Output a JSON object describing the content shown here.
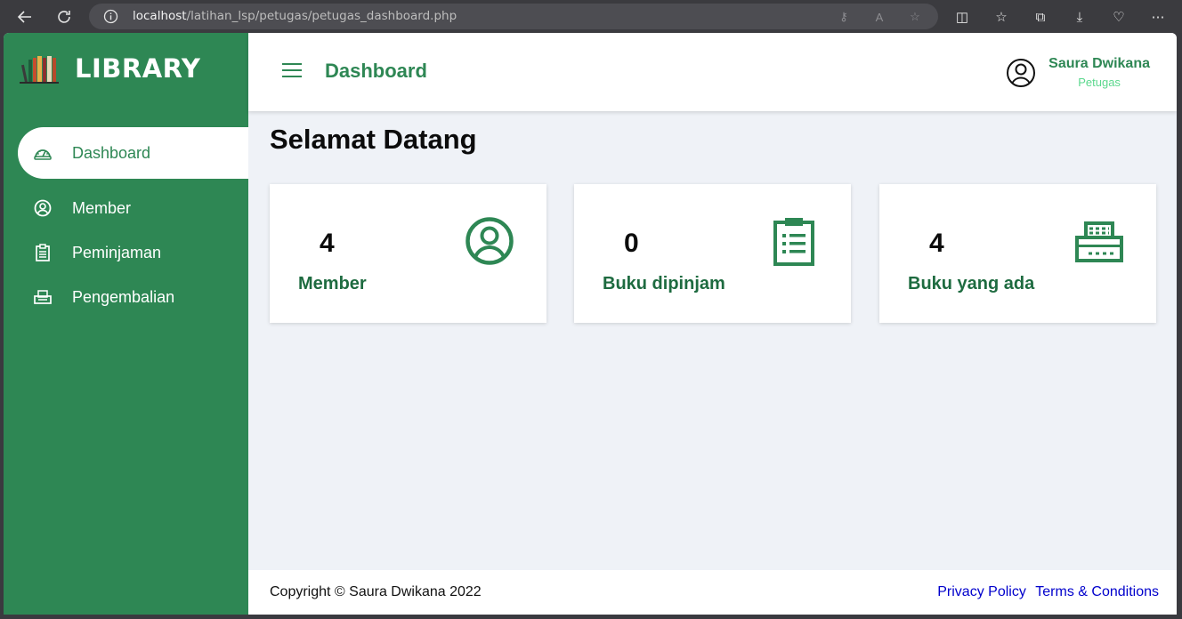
{
  "browser": {
    "url_host": "localhost",
    "url_path": "/latihan_lsp/petugas/petugas_dashboard.php"
  },
  "sidebar": {
    "brand": "LIBRARY",
    "items": [
      {
        "label": "Dashboard",
        "icon": "dashboard-icon",
        "active": true
      },
      {
        "label": "Member",
        "icon": "user-circle-icon",
        "active": false
      },
      {
        "label": "Peminjaman",
        "icon": "clipboard-icon",
        "active": false
      },
      {
        "label": "Pengembalian",
        "icon": "printer-icon",
        "active": false
      }
    ]
  },
  "header": {
    "title": "Dashboard",
    "user_name": "Saura Dwikana",
    "user_role": "Petugas"
  },
  "main": {
    "welcome": "Selamat Datang",
    "cards": [
      {
        "count": "4",
        "label": "Member",
        "icon": "user-circle-icon"
      },
      {
        "count": "0",
        "label": "Buku dipinjam",
        "icon": "clipboard-icon"
      },
      {
        "count": "4",
        "label": "Buku yang ada",
        "icon": "receipt-printer-icon"
      }
    ]
  },
  "footer": {
    "copyright": "Copyright © Saura Dwikana 2022",
    "privacy": "Privacy Policy",
    "terms": "Terms & Conditions"
  },
  "colors": {
    "brand_green": "#2e8754",
    "role_green": "#5bd88d",
    "background": "#eff2f7"
  }
}
